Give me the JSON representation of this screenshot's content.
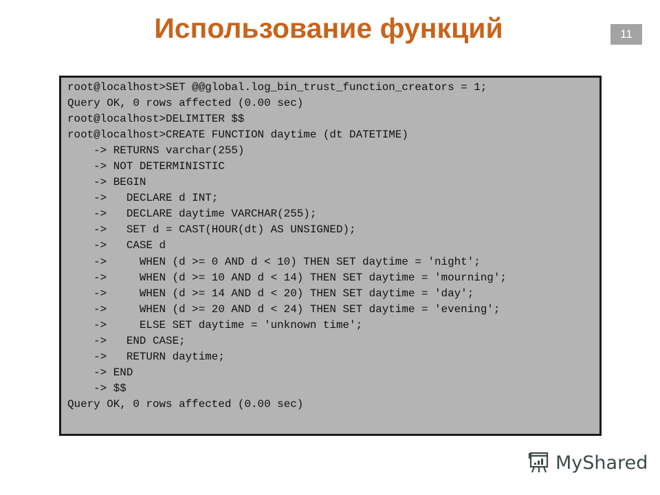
{
  "slide": {
    "title": "Использование функций",
    "page_number": "11"
  },
  "console": {
    "lines": [
      "root@localhost>SET @@global.log_bin_trust_function_creators = 1;",
      "Query OK, 0 rows affected (0.00 sec)",
      "root@localhost>DELIMITER $$",
      "root@localhost>CREATE FUNCTION daytime (dt DATETIME)",
      "    -> RETURNS varchar(255)",
      "    -> NOT DETERMINISTIC",
      "    -> BEGIN",
      "    ->   DECLARE d INT;",
      "    ->   DECLARE daytime VARCHAR(255);",
      "    ->   SET d = CAST(HOUR(dt) AS UNSIGNED);",
      "    ->   CASE d",
      "    ->     WHEN (d >= 0 AND d < 10) THEN SET daytime = 'night';",
      "    ->     WHEN (d >= 10 AND d < 14) THEN SET daytime = 'mourning';",
      "    ->     WHEN (d >= 14 AND d < 20) THEN SET daytime = 'day';",
      "    ->     WHEN (d >= 20 AND d < 24) THEN SET daytime = 'evening';",
      "    ->     ELSE SET daytime = 'unknown time';",
      "    ->   END CASE;",
      "    ->   RETURN daytime;",
      "    -> END",
      "    -> $$",
      "Query OK, 0 rows affected (0.00 sec)"
    ]
  },
  "logo": {
    "text": "MyShared",
    "icon": "presentation-board-icon"
  },
  "colors": {
    "title": "#c8641c",
    "badge": "#a3a3a3",
    "console_bg": "#b4b4b4"
  }
}
